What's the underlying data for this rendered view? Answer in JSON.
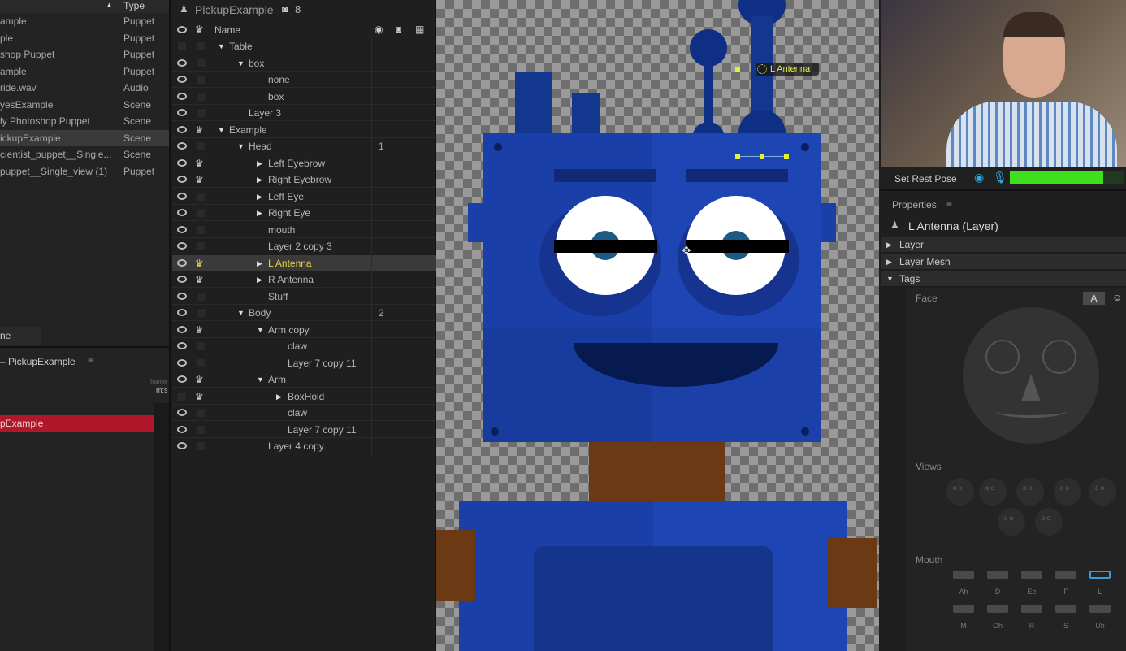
{
  "project": {
    "type_header": "Type",
    "sort_icon": "triangle-up-icon",
    "items": [
      {
        "name": "ample",
        "type": "Puppet"
      },
      {
        "name": "ple",
        "type": "Puppet"
      },
      {
        "name": "shop Puppet",
        "type": "Puppet"
      },
      {
        "name": "ample",
        "type": "Puppet"
      },
      {
        "name": "ride.wav",
        "type": "Audio"
      },
      {
        "name": "yesExample",
        "type": "Scene"
      },
      {
        "name": "ly Photoshop Puppet",
        "type": "Scene"
      },
      {
        "name": "ickupExample",
        "type": "Scene",
        "selected": true
      },
      {
        "name": "cientist_puppet__Single...",
        "type": "Scene"
      },
      {
        "name": "puppet__Single_view (1)",
        "type": "Puppet"
      }
    ],
    "tab": "ne"
  },
  "timeline": {
    "title": "– PickupExample",
    "frame_label": "frame",
    "time_label": "m:s",
    "track": "pExample",
    "track_color": "#b0172a"
  },
  "layers": {
    "puppet_name": "PickupExample",
    "camera_count": "8",
    "name_header": "Name",
    "rows": [
      {
        "name": "Table",
        "level": 0,
        "arrow": "open",
        "eye": false,
        "crown": false
      },
      {
        "name": "box",
        "level": 1,
        "arrow": "open",
        "eye": true,
        "crown": false
      },
      {
        "name": "none",
        "level": 2,
        "eye": true
      },
      {
        "name": "box",
        "level": 2,
        "eye": true
      },
      {
        "name": "Layer 3",
        "level": 1,
        "eye": true
      },
      {
        "name": "Example",
        "level": 0,
        "arrow": "open",
        "eye": true,
        "crown": true
      },
      {
        "name": "Head",
        "level": 1,
        "arrow": "open",
        "eye": true,
        "value": "1"
      },
      {
        "name": "Left Eyebrow",
        "level": 2,
        "arrow": "closed",
        "eye": true,
        "crown": true
      },
      {
        "name": "Right Eyebrow",
        "level": 2,
        "arrow": "closed",
        "eye": true,
        "crown": true
      },
      {
        "name": "Left Eye",
        "level": 2,
        "arrow": "closed",
        "eye": true
      },
      {
        "name": "Right Eye",
        "level": 2,
        "arrow": "closed",
        "eye": true
      },
      {
        "name": "mouth",
        "level": 2,
        "eye": true
      },
      {
        "name": "Layer 2 copy 3",
        "level": 2,
        "eye": true
      },
      {
        "name": "L Antenna",
        "level": 2,
        "arrow": "closed",
        "eye": true,
        "crown": true,
        "selected": true
      },
      {
        "name": "R Antenna",
        "level": 2,
        "arrow": "closed",
        "eye": true,
        "crown": true
      },
      {
        "name": "Stuff",
        "level": 2,
        "eye": true
      },
      {
        "name": "Body",
        "level": 1,
        "arrow": "open",
        "eye": true,
        "value": "2"
      },
      {
        "name": "Arm copy",
        "level": 2,
        "arrow": "open",
        "eye": true,
        "crown": true
      },
      {
        "name": "claw",
        "level": 3,
        "eye": true
      },
      {
        "name": "Layer 7 copy 11",
        "level": 3,
        "eye": true
      },
      {
        "name": "Arm",
        "level": 2,
        "arrow": "open",
        "eye": true,
        "crown": true
      },
      {
        "name": "BoxHold",
        "level": 3,
        "arrow": "closed",
        "eye": false,
        "crown": true
      },
      {
        "name": "claw",
        "level": 3,
        "eye": true
      },
      {
        "name": "Layer 7 copy 11",
        "level": 3,
        "eye": true
      },
      {
        "name": "Layer 4 copy",
        "level": 2,
        "eye": true
      }
    ]
  },
  "canvas": {
    "handle_label": "L Antenna",
    "handle_color": "#e6f03c",
    "robot_color": "#1a3fa8"
  },
  "camera": {
    "set_rest_pose": "Set Rest Pose",
    "audio_level": 0.82,
    "level_color": "#3ee01e"
  },
  "properties": {
    "title": "Properties",
    "layer_title": "L Antenna (Layer)",
    "sections": [
      "Layer",
      "Layer Mesh",
      "Tags"
    ],
    "face_label": "Face",
    "face_mode": "A",
    "views_label": "Views",
    "mouth_label": "Mouth",
    "mouth_shapes": [
      "Ah",
      "D",
      "Ee",
      "F",
      "L",
      "M",
      "Oh",
      "R",
      "S",
      "Uh"
    ],
    "selected_mouth": "L"
  }
}
